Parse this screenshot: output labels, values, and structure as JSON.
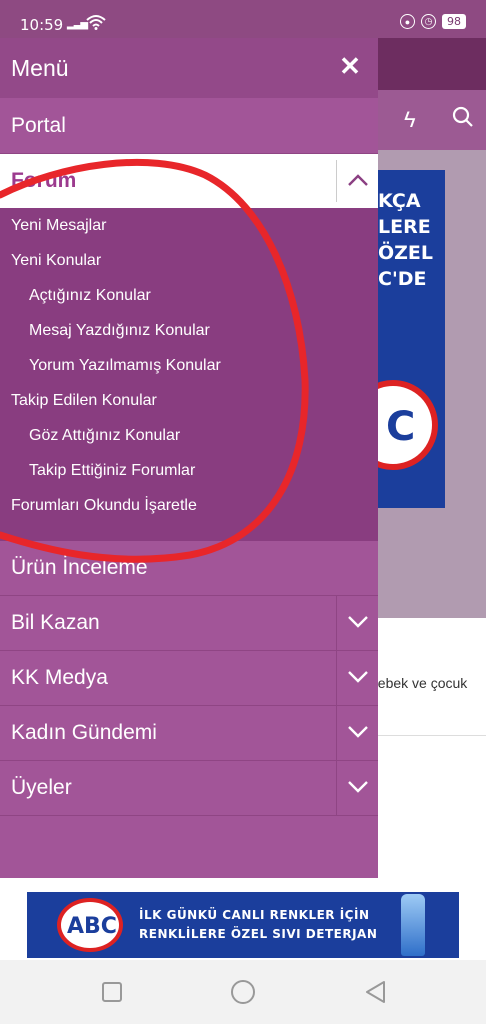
{
  "status_bar": {
    "time": "10:59",
    "battery": "98"
  },
  "drawer": {
    "title": "Menü",
    "close_icon": "close-icon",
    "items": [
      {
        "label": "Portal"
      },
      {
        "label": "Forum",
        "expanded": true
      },
      {
        "label": "Ürün İnceleme"
      },
      {
        "label": "Bil Kazan"
      },
      {
        "label": "KK Medya"
      },
      {
        "label": "Kadın Gündemi"
      },
      {
        "label": "Üyeler"
      }
    ],
    "forum_submenu": [
      "Yeni Mesajlar",
      "Yeni Konular",
      "Açtığınız Konular",
      "Mesaj Yazdığınız Konular",
      "Yorum Yazılmamış Konular",
      "Takip Edilen Konular",
      "Göz Attığınız Konular",
      "Takip Ettiğiniz Forumlar",
      "Forumları Okundu İşaretle"
    ]
  },
  "background_page": {
    "ad_text": "KÇA\nLERE\nÖZEL\nC'DE",
    "ad_logo": "C",
    "card_text": "bebek ve çocuk",
    "icons": [
      "bolt-icon",
      "search-icon"
    ]
  },
  "bottom_ad": {
    "logo": "ABC",
    "line1": "İLK GÜNKÜ CANLI RENKLER İÇİN",
    "line2": "RENKLİLERE ÖZEL SIVI DETERJAN"
  },
  "colors": {
    "drawer_bg": "#a25598",
    "drawer_header": "#934989",
    "submenu_bg": "#893d80",
    "annotation": "#e8262a",
    "forum_active_text": "#9c3a8e"
  }
}
